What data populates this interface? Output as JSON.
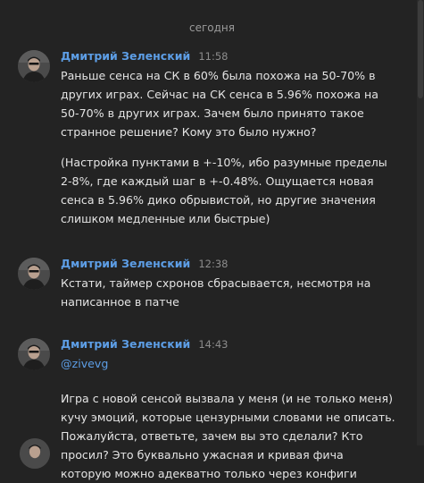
{
  "date_divider": "сегодня",
  "messages": [
    {
      "author": "Дмитрий Зеленский",
      "time": "11:58",
      "paragraphs": [
        "Раньше сенса на СК в 60% была похожа на 50-70% в других играх. Сейчас на СК сенса в 5.96% похожа на 50-70% в других играх. Зачем было принято такое странное решение? Кому это было нужно?",
        "(Настройка пунктами в +-10%, ибо разумные пределы 2-8%, где каждый шаг в +-0.48%. Ощущается новая сенса в 5.96% дико обрывистой, но другие значения слишком медленные или быстрые)"
      ]
    },
    {
      "author": "Дмитрий Зеленский",
      "time": "12:38",
      "paragraphs": [
        "Кстати, таймер схронов сбрасывается, несмотря на написанное в патче"
      ]
    },
    {
      "author": "Дмитрий Зеленский",
      "time": "14:43",
      "mention": "@zivevg",
      "paragraphs": [
        "Игра с новой сенсой вызвала у меня (и не только меня) кучу эмоций, которые цензурными словами не описать. Пожалуйста, ответьте, зачем вы это сделали? Кто просил? Это буквально ужасная и кривая фича которую можно адекватно только через конфиги"
      ]
    }
  ],
  "icons": {
    "avatar": "user-avatar-photo"
  },
  "colors": {
    "background": "#232323",
    "author": "#5d9ee6",
    "mention": "#5d9ee6",
    "text": "#e4e4e4",
    "time": "#8c8c8c"
  }
}
